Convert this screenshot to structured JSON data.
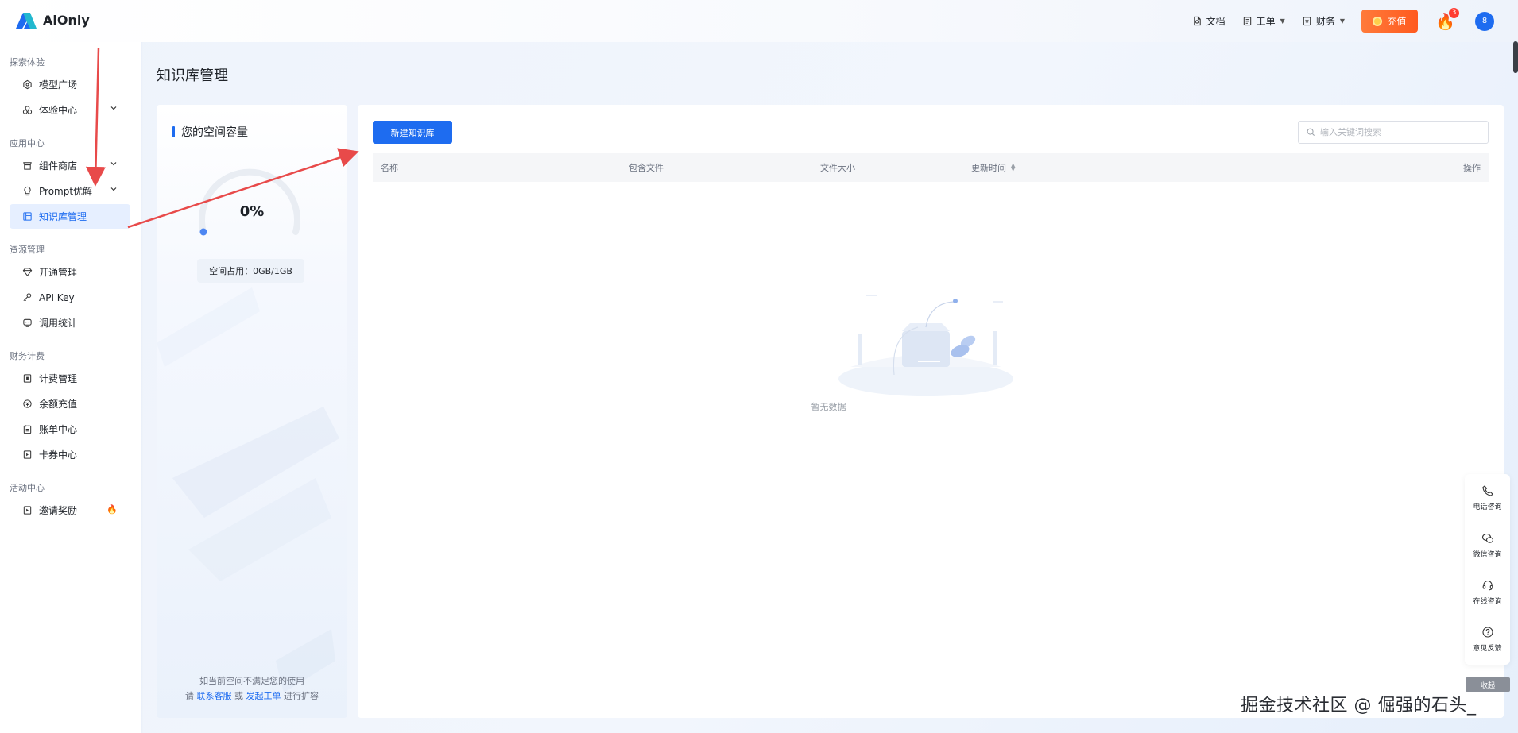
{
  "header": {
    "logo_text": "AiOnly",
    "nav": [
      {
        "label": "文档",
        "icon": "doc-icon"
      },
      {
        "label": "工单",
        "icon": "ticket-icon",
        "dropdown": true
      },
      {
        "label": "财务",
        "icon": "finance-icon",
        "dropdown": true
      }
    ],
    "recharge_label": "充值",
    "fire_badge": "3",
    "avatar_text": "8"
  },
  "sidebar": {
    "groups": [
      {
        "label": "探索体验",
        "items": [
          {
            "label": "模型广场",
            "icon": "model-square-icon"
          },
          {
            "label": "体验中心",
            "icon": "experience-icon",
            "expandable": true
          }
        ]
      },
      {
        "label": "应用中心",
        "items": [
          {
            "label": "组件商店",
            "icon": "store-icon",
            "expandable": true
          },
          {
            "label": "Prompt优解",
            "icon": "bulb-icon",
            "expandable": true
          },
          {
            "label": "知识库管理",
            "icon": "kb-icon",
            "active": true
          }
        ]
      },
      {
        "label": "资源管理",
        "items": [
          {
            "label": "开通管理",
            "icon": "diamond-icon"
          },
          {
            "label": "API Key",
            "icon": "key-icon"
          },
          {
            "label": "调用统计",
            "icon": "stats-icon"
          }
        ]
      },
      {
        "label": "财务计费",
        "items": [
          {
            "label": "计费管理",
            "icon": "billing-icon"
          },
          {
            "label": "余额充值",
            "icon": "balance-icon"
          },
          {
            "label": "账单中心",
            "icon": "bill-icon"
          },
          {
            "label": "卡券中心",
            "icon": "coupon-icon"
          }
        ]
      },
      {
        "label": "活动中心",
        "items": [
          {
            "label": "邀请奖励",
            "icon": "gift-icon",
            "hot": true
          }
        ]
      }
    ]
  },
  "page": {
    "title": "知识库管理"
  },
  "capacity": {
    "title": "您的空间容量",
    "percent": "0%",
    "percent_value": 0,
    "usage_label": "空间占用：",
    "usage_value": "0GB/1GB",
    "note_line1": "如当前空间不满足您的使用",
    "note_prefix": "请",
    "note_link1": "联系客服",
    "note_or": "或",
    "note_link2": "发起工单",
    "note_suffix": "进行扩容"
  },
  "kb_table": {
    "new_button": "新建知识库",
    "search_placeholder": "输入关键词搜索",
    "columns": [
      "名称",
      "包含文件",
      "文件大小",
      "更新时间",
      "操作"
    ],
    "rows": [],
    "empty_text": "暂无数据"
  },
  "service_panel": {
    "items": [
      {
        "label": "电话咨询",
        "icon": "phone-icon"
      },
      {
        "label": "微信咨询",
        "icon": "wechat-icon"
      },
      {
        "label": "在线咨询",
        "icon": "headset-icon"
      },
      {
        "label": "意见反馈",
        "icon": "question-icon"
      }
    ],
    "collapse_label": "收起"
  },
  "watermark": "掘金技术社区 @ 倔强的石头_",
  "colors": {
    "accent": "#1e6cf0",
    "recharge": "#ff5a1f",
    "annotation": "#e84a4a"
  }
}
